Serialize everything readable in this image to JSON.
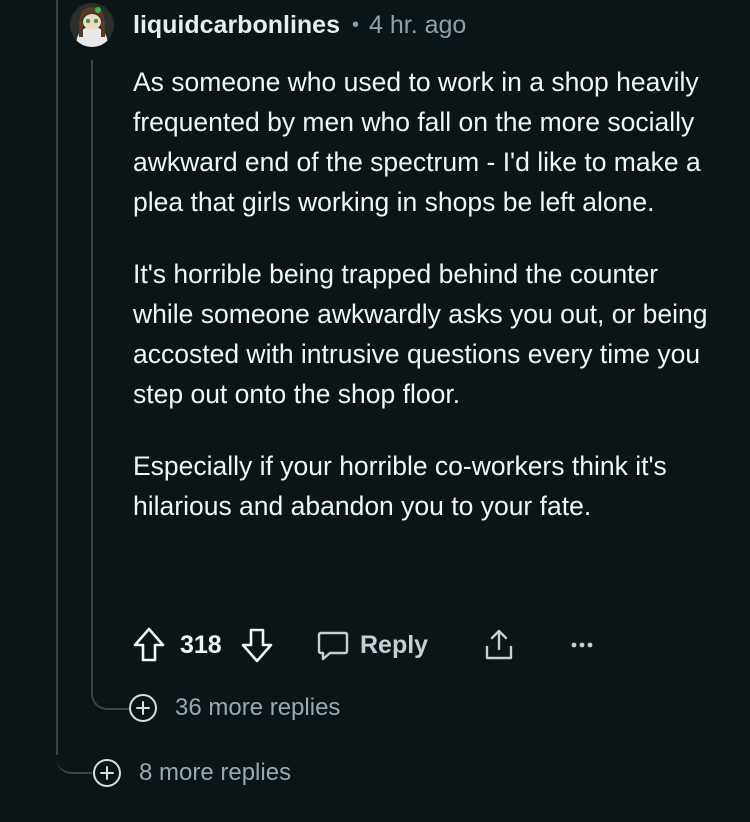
{
  "comment": {
    "username": "liquidcarbonlines",
    "separator": "•",
    "time": "4 hr. ago",
    "paragraphs": [
      "As someone who used to work in a shop heavily frequented by men who fall on the more socially awkward end of the spectrum - I'd like to make a plea that girls working in shops be left alone.",
      "It's horrible being trapped behind the counter while someone awkwardly asks you out, or being accosted with intrusive questions every time you step out onto the shop floor.",
      "Especially if your horrible co-workers think it's hilarious and abandon you to your fate."
    ],
    "score": "318",
    "reply_label": "Reply",
    "icons": {
      "upvote": "upvote-arrow-icon",
      "downvote": "downvote-arrow-icon",
      "reply": "speech-bubble-icon",
      "share": "share-icon",
      "more": "ellipsis-icon"
    }
  },
  "more_replies_nested": "36 more replies",
  "more_replies_outer": "8 more replies",
  "colors": {
    "background": "#0b1416",
    "text": "#f2f4f5",
    "muted": "#8ba2ad",
    "thread_line": "#3a4347"
  }
}
